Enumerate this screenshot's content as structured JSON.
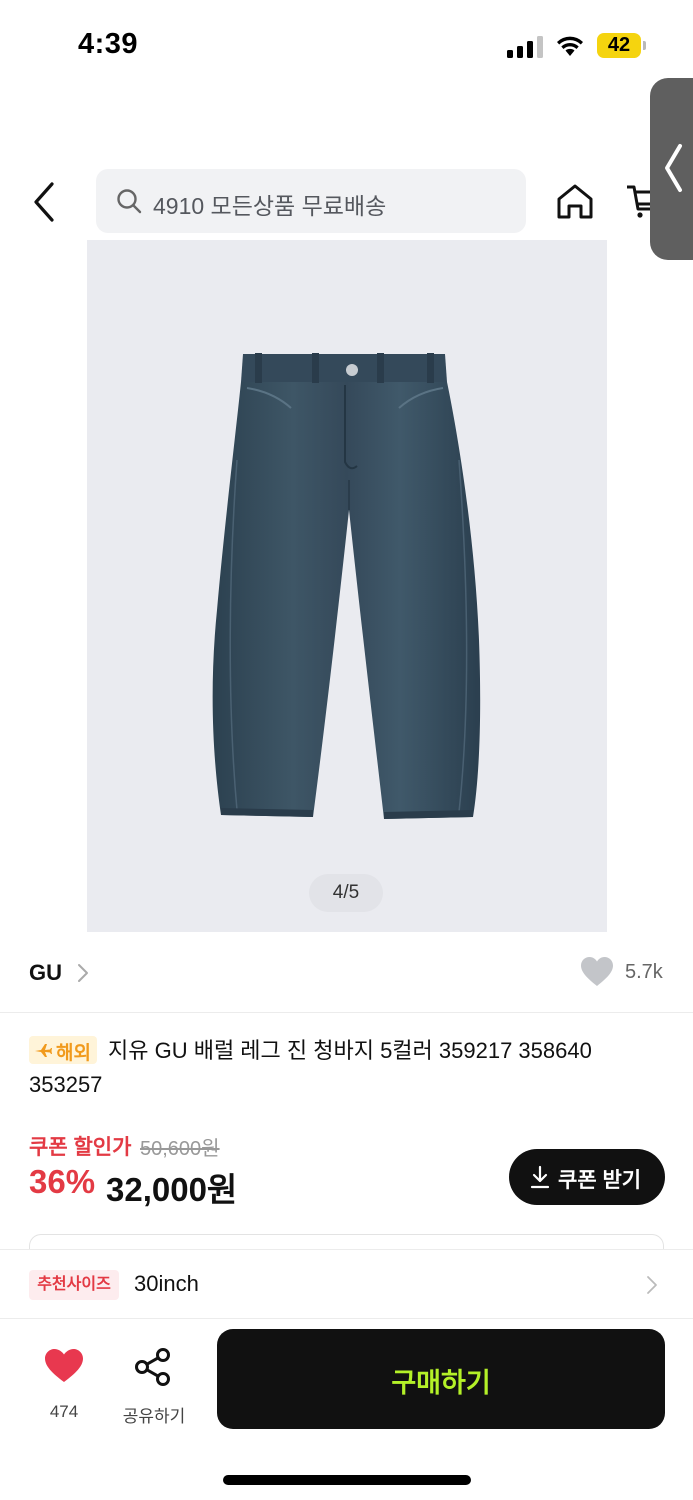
{
  "status_bar": {
    "time": "4:39",
    "battery": "42"
  },
  "header": {
    "search_placeholder": "4910 모든상품 무료배송",
    "icons": [
      "back-arrow-icon",
      "search-icon",
      "home-icon",
      "cart-icon",
      "chevron-left-icon"
    ]
  },
  "gallery": {
    "counter": "4/5"
  },
  "brand": {
    "name": "GU",
    "likes": "5.7k"
  },
  "product": {
    "badge": "해외",
    "title": "지유 GU 배럴 레그 진 청바지 5컬러 359217 358640 353257"
  },
  "price": {
    "coupon_label": "쿠폰 할인가",
    "original": "50,600원",
    "discount": "36%",
    "final": "32,000원",
    "coupon_button": "쿠폰 받기"
  },
  "size_recommendation": {
    "label": "추천사이즈",
    "value": "30inch"
  },
  "bottom_bar": {
    "like_count": "474",
    "share_label": "공유하기",
    "buy_label": "구매하기"
  },
  "colors": {
    "discount_red": "#e33a44",
    "buy_accent": "#b4f128",
    "overseas_orange": "#f19a1c",
    "battery_yellow": "#f5d40f"
  }
}
